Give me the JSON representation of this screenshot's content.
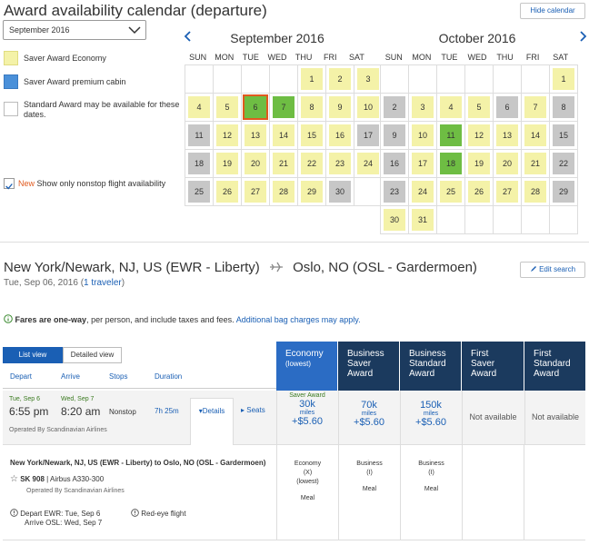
{
  "header": {
    "title": "Award availability calendar (departure)",
    "hide_calendar": "Hide calendar",
    "month_select_value": "September 2016"
  },
  "legend": [
    {
      "label": "Saver Award Economy",
      "color": "#f4f2a8"
    },
    {
      "label": "Saver Award premium cabin",
      "color": "#4a90d9"
    },
    {
      "label": "Standard Award may be available for these dates.",
      "color": "#ffffff"
    }
  ],
  "nonstop": {
    "new_label": "New",
    "label": "Show only nonstop flight availability",
    "checked": true
  },
  "calendar": {
    "dow": [
      "SUN",
      "MON",
      "TUE",
      "WED",
      "THU",
      "FRI",
      "SAT"
    ],
    "months": [
      {
        "title": "September 2016",
        "first_weekday": 4,
        "days": [
          {
            "d": "1",
            "s": "saver"
          },
          {
            "d": "2",
            "s": "saver"
          },
          {
            "d": "3",
            "s": "saver"
          },
          {
            "d": "4",
            "s": "saver"
          },
          {
            "d": "5",
            "s": "saver"
          },
          {
            "d": "6",
            "s": "start"
          },
          {
            "d": "7",
            "s": "selected"
          },
          {
            "d": "8",
            "s": "saver"
          },
          {
            "d": "9",
            "s": "saver"
          },
          {
            "d": "10",
            "s": "saver"
          },
          {
            "d": "11",
            "s": "gray"
          },
          {
            "d": "12",
            "s": "saver"
          },
          {
            "d": "13",
            "s": "saver"
          },
          {
            "d": "14",
            "s": "saver"
          },
          {
            "d": "15",
            "s": "saver"
          },
          {
            "d": "16",
            "s": "saver"
          },
          {
            "d": "17",
            "s": "gray"
          },
          {
            "d": "18",
            "s": "gray"
          },
          {
            "d": "19",
            "s": "saver"
          },
          {
            "d": "20",
            "s": "saver"
          },
          {
            "d": "21",
            "s": "saver"
          },
          {
            "d": "22",
            "s": "saver"
          },
          {
            "d": "23",
            "s": "saver"
          },
          {
            "d": "24",
            "s": "saver"
          },
          {
            "d": "25",
            "s": "gray"
          },
          {
            "d": "26",
            "s": "saver"
          },
          {
            "d": "27",
            "s": "saver"
          },
          {
            "d": "28",
            "s": "saver"
          },
          {
            "d": "29",
            "s": "saver"
          },
          {
            "d": "30",
            "s": "gray"
          }
        ]
      },
      {
        "title": "October 2016",
        "first_weekday": 6,
        "days": [
          {
            "d": "1",
            "s": "saver"
          },
          {
            "d": "2",
            "s": "gray"
          },
          {
            "d": "3",
            "s": "saver"
          },
          {
            "d": "4",
            "s": "saver"
          },
          {
            "d": "5",
            "s": "saver"
          },
          {
            "d": "6",
            "s": "gray"
          },
          {
            "d": "7",
            "s": "saver"
          },
          {
            "d": "8",
            "s": "gray"
          },
          {
            "d": "9",
            "s": "gray"
          },
          {
            "d": "10",
            "s": "saver"
          },
          {
            "d": "11",
            "s": "selected"
          },
          {
            "d": "12",
            "s": "saver"
          },
          {
            "d": "13",
            "s": "saver"
          },
          {
            "d": "14",
            "s": "saver"
          },
          {
            "d": "15",
            "s": "gray"
          },
          {
            "d": "16",
            "s": "gray"
          },
          {
            "d": "17",
            "s": "saver"
          },
          {
            "d": "18",
            "s": "selected"
          },
          {
            "d": "19",
            "s": "saver"
          },
          {
            "d": "20",
            "s": "saver"
          },
          {
            "d": "21",
            "s": "saver"
          },
          {
            "d": "22",
            "s": "gray"
          },
          {
            "d": "23",
            "s": "gray"
          },
          {
            "d": "24",
            "s": "saver"
          },
          {
            "d": "25",
            "s": "saver"
          },
          {
            "d": "26",
            "s": "saver"
          },
          {
            "d": "27",
            "s": "saver"
          },
          {
            "d": "28",
            "s": "saver"
          },
          {
            "d": "29",
            "s": "gray"
          },
          {
            "d": "30",
            "s": "saver"
          },
          {
            "d": "31",
            "s": "saver"
          }
        ]
      }
    ]
  },
  "route": {
    "origin": "New York/Newark, NJ, US (EWR - Liberty)",
    "destination": "Oslo, NO (OSL - Gardermoen)",
    "date": "Tue, Sep 06, 2016",
    "travelers": "1 traveler",
    "edit_search": "Edit search"
  },
  "fares_note": {
    "bold": "Fares are one-way",
    "text": ", per person, and include taxes and fees.",
    "link": "Additional bag charges may apply."
  },
  "views": {
    "list": "List view",
    "detailed": "Detailed view"
  },
  "columns": {
    "depart": "Depart",
    "arrive": "Arrive",
    "stops": "Stops",
    "duration": "Duration"
  },
  "fare_columns": [
    {
      "title": "Economy",
      "sub": "(lowest)"
    },
    {
      "title": "Business Saver Award",
      "sub": ""
    },
    {
      "title": "Business Standard Award",
      "sub": ""
    },
    {
      "title": "First Saver Award",
      "sub": ""
    },
    {
      "title": "First Standard Award",
      "sub": ""
    }
  ],
  "flight": {
    "depart_date": "Tue, Sep 6",
    "depart_time": "6:55 pm",
    "arrive_date": "Wed, Sep 7",
    "arrive_time": "8:20 am",
    "stops": "Nonstop",
    "duration": "7h 25m",
    "details": "Details",
    "seats": "Seats",
    "operated_by": "Operated By Scandinavian Airlines",
    "fares": [
      {
        "label": "Saver Award",
        "miles": "30k",
        "unit": "miles",
        "tax": "+$5.60"
      },
      {
        "label": "",
        "miles": "70k",
        "unit": "miles",
        "tax": "+$5.60"
      },
      {
        "label": "",
        "miles": "150k",
        "unit": "miles",
        "tax": "+$5.60"
      },
      {
        "label": "Not available"
      },
      {
        "label": "Not available"
      }
    ]
  },
  "detail": {
    "route": "New York/Newark, NJ, US (EWR - Liberty) to Oslo, NO (OSL - Gardermoen)",
    "flight_no": "SK 908",
    "aircraft": "| Airbus A330-300",
    "operated": "Operated By Scandinavian Airlines",
    "depart_note": "Depart EWR: Tue, Sep 6",
    "arrive_note": "Arrive OSL: Wed, Sep 7",
    "redeye": "Red-eye flight",
    "cabins": [
      {
        "cabin": "Economy",
        "code": "(X)",
        "extra": "(lowest)",
        "meal": "Meal"
      },
      {
        "cabin": "Business",
        "code": "(I)",
        "extra": "",
        "meal": "Meal"
      },
      {
        "cabin": "Business",
        "code": "(I)",
        "extra": "",
        "meal": "Meal"
      }
    ]
  }
}
